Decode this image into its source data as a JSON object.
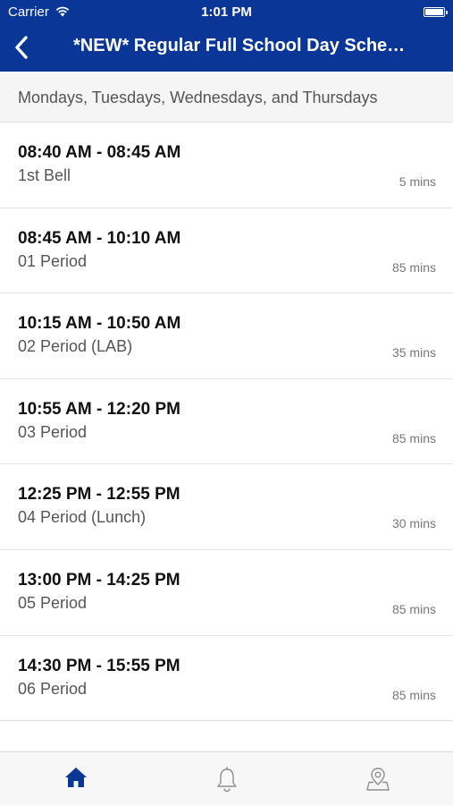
{
  "status_bar": {
    "carrier": "Carrier",
    "time": "1:01 PM"
  },
  "nav": {
    "title": "*NEW* Regular Full School Day Sche…",
    "back_icon": "chevron-left-icon"
  },
  "schedule": {
    "days_header": "Mondays, Tuesdays, Wednesdays, and Thursdays",
    "items": [
      {
        "time": "08:40 AM - 08:45 AM",
        "label": "1st Bell",
        "duration": "5 mins"
      },
      {
        "time": "08:45 AM - 10:10 AM",
        "label": "01 Period",
        "duration": "85 mins"
      },
      {
        "time": "10:15 AM - 10:50 AM",
        "label": "02 Period (LAB)",
        "duration": "35 mins"
      },
      {
        "time": "10:55 AM - 12:20 PM",
        "label": "03 Period",
        "duration": "85 mins"
      },
      {
        "time": "12:25 PM - 12:55 PM",
        "label": "04 Period (Lunch)",
        "duration": "30 mins"
      },
      {
        "time": "13:00 PM - 14:25 PM",
        "label": "05 Period",
        "duration": "85 mins"
      },
      {
        "time": "14:30 PM - 15:55 PM",
        "label": "06 Period",
        "duration": "85 mins"
      }
    ]
  },
  "tab_bar": {
    "tabs": [
      {
        "icon": "home-icon",
        "active": true
      },
      {
        "icon": "bell-icon",
        "active": false
      },
      {
        "icon": "map-pin-icon",
        "active": false
      }
    ],
    "active_color": "#0a3797",
    "inactive_color": "#8e8e8e"
  },
  "colors": {
    "brand": "#0a3797",
    "header_bg": "#f5f5f5"
  }
}
